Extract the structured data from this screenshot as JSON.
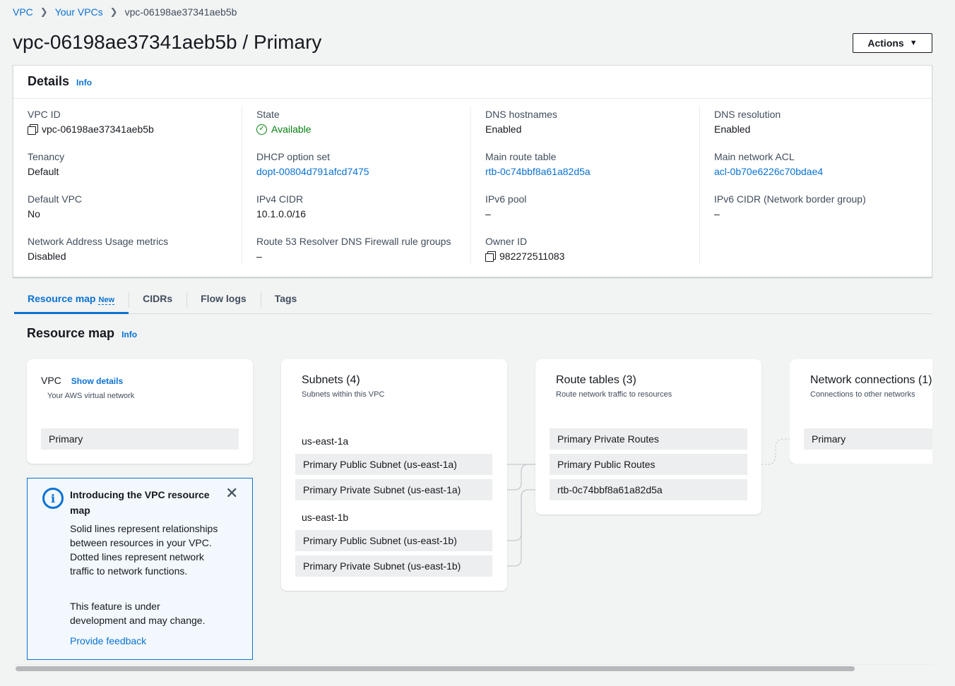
{
  "breadcrumb": {
    "items": [
      "VPC",
      "Your VPCs"
    ],
    "current": "vpc-06198ae37341aeb5b"
  },
  "page": {
    "title": "vpc-06198ae37341aeb5b / Primary",
    "actions_label": "Actions"
  },
  "details": {
    "title": "Details",
    "info": "Info",
    "columns": [
      [
        {
          "label": "VPC ID",
          "value": "vpc-06198ae37341aeb5b"
        },
        {
          "label": "Tenancy",
          "value": "Default"
        },
        {
          "label": "Default VPC",
          "value": "No"
        },
        {
          "label": "Network Address Usage metrics",
          "value": "Disabled"
        }
      ],
      [
        {
          "label": "State",
          "value": "Available"
        },
        {
          "label": "DHCP option set",
          "value": "dopt-00804d791afcd7475"
        },
        {
          "label": "IPv4 CIDR",
          "value": "10.1.0.0/16"
        },
        {
          "label": "Route 53 Resolver DNS Firewall rule groups",
          "value": "–"
        }
      ],
      [
        {
          "label": "DNS hostnames",
          "value": "Enabled"
        },
        {
          "label": "Main route table",
          "value": "rtb-0c74bbf8a61a82d5a"
        },
        {
          "label": "IPv6 pool",
          "value": "–"
        },
        {
          "label": "Owner ID",
          "value": "982272511083"
        }
      ],
      [
        {
          "label": "DNS resolution",
          "value": "Enabled"
        },
        {
          "label": "Main network ACL",
          "value": "acl-0b70e6226c70bdae4"
        },
        {
          "label": "IPv6 CIDR (Network border group)",
          "value": "–"
        }
      ]
    ]
  },
  "tabs": [
    {
      "label": "Resource map",
      "badge": "New",
      "active": true
    },
    {
      "label": "CIDRs"
    },
    {
      "label": "Flow logs"
    },
    {
      "label": "Tags"
    }
  ],
  "resource_map": {
    "title": "Resource map",
    "info": "Info",
    "vpc": {
      "title": "VPC",
      "show_details": "Show details",
      "subtitle": "Your AWS virtual network",
      "node": "Primary"
    },
    "subnets": {
      "title": "Subnets (4)",
      "subtitle": "Subnets within this VPC",
      "zones": [
        {
          "name": "us-east-1a",
          "items": [
            "Primary Public Subnet (us-east-1a)",
            "Primary Private Subnet (us-east-1a)"
          ]
        },
        {
          "name": "us-east-1b",
          "items": [
            "Primary Public Subnet (us-east-1b)",
            "Primary Private Subnet (us-east-1b)"
          ]
        }
      ]
    },
    "route_tables": {
      "title": "Route tables (3)",
      "subtitle": "Route network traffic to resources",
      "items": [
        "Primary Private Routes",
        "Primary Public Routes",
        "rtb-0c74bbf8a61a82d5a"
      ]
    },
    "network_connections": {
      "title": "Network connections (1)",
      "subtitle": "Connections to other networks",
      "items": [
        "Primary"
      ]
    }
  },
  "alert": {
    "title": "Introducing the VPC resource map",
    "body": "Solid lines represent relationships between resources in your VPC. Dotted lines represent network traffic to network functions.",
    "body2": "This feature is under development and may change.",
    "feedback": "Provide feedback"
  },
  "colors": {
    "link": "#0972d3",
    "success": "#037f0c",
    "alert_bg": "#f2f8fd"
  }
}
